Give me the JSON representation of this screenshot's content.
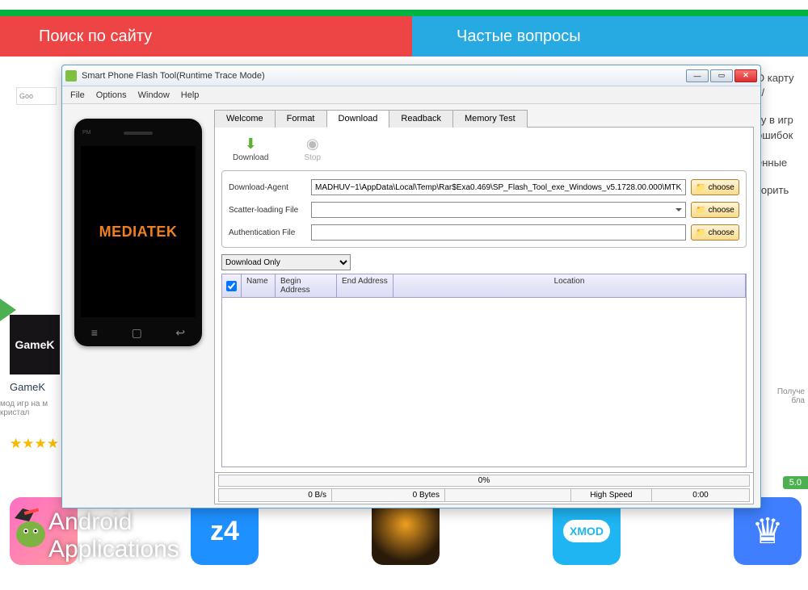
{
  "background": {
    "search_text": "Поиск по сайту",
    "faq_text": "Частые вопросы",
    "right_texts": [
      "О карту x/",
      "ку в игр ошибок",
      "енные",
      "корить"
    ],
    "left_card": "GameK",
    "left_label": "GameK",
    "left_small": "мод игр на м кристал",
    "right_small": "Получе бла",
    "badge": "5.0",
    "xmod_text": "XMOD",
    "z4_text": "z4",
    "watermark_line1": "Android",
    "watermark_line2": "Applications",
    "google": "Goo"
  },
  "win": {
    "title": "Smart Phone Flash Tool(Runtime Trace Mode)",
    "menu": {
      "file": "File",
      "options": "Options",
      "window": "Window",
      "help": "Help"
    },
    "tabs": {
      "welcome": "Welcome",
      "format": "Format",
      "download": "Download",
      "readback": "Readback",
      "memory_test": "Memory Test"
    },
    "tools": {
      "download": "Download",
      "stop": "Stop"
    },
    "fields": {
      "da_label": "Download-Agent",
      "da_value": "MADHUV~1\\AppData\\Local\\Temp\\Rar$Exa0.469\\SP_Flash_Tool_exe_Windows_v5.1728.00.000\\MTK_AllInOne_DA.bin",
      "scatter_label": "Scatter-loading File",
      "scatter_value": "",
      "auth_label": "Authentication File",
      "auth_value": "",
      "choose": "choose"
    },
    "mode": "Download Only",
    "grid": {
      "name": "Name",
      "begin": "Begin Address",
      "end": "End Address",
      "location": "Location"
    },
    "progress": {
      "pct": "0%",
      "rate": "0 B/s",
      "bytes": "0 Bytes",
      "speed": "High Speed",
      "time": "0:00"
    },
    "phone": {
      "brand": "MEDIATEK",
      "pm": "PM"
    }
  }
}
